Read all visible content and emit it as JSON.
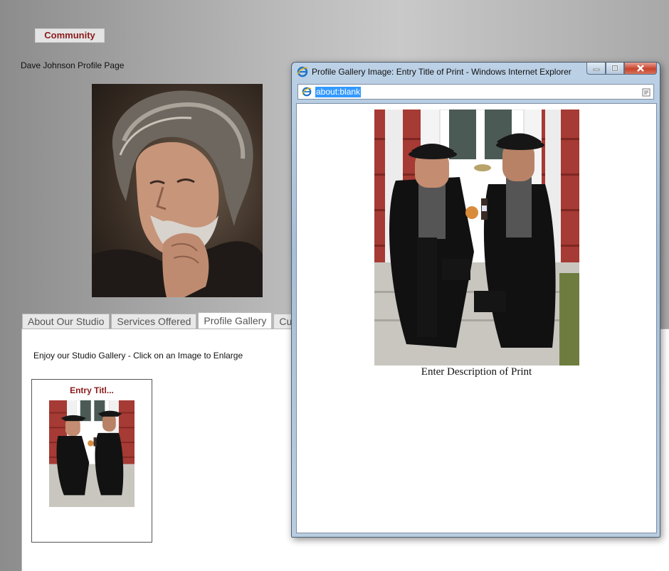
{
  "page": {
    "nav_button": "Community",
    "profile_title": "Dave Johnson Profile Page",
    "tabs": [
      {
        "label": "About Our Studio"
      },
      {
        "label": "Services Offered"
      },
      {
        "label": "Profile Gallery"
      },
      {
        "label": "Curre"
      }
    ],
    "active_tab": "Profile Gallery",
    "gallery_intro": "Enjoy our Studio Gallery - Click on an Image to Enlarge",
    "entry": {
      "title": "Entry Titl..."
    }
  },
  "popup": {
    "title": "Profile Gallery Image: Entry Title of Print - Windows Internet Explorer",
    "address": "about:blank",
    "description": "Enter Description of Print"
  },
  "colors": {
    "accent_red": "#8b1a1a",
    "selection_blue": "#3399ff",
    "window_frame": "#a7bfd7"
  }
}
